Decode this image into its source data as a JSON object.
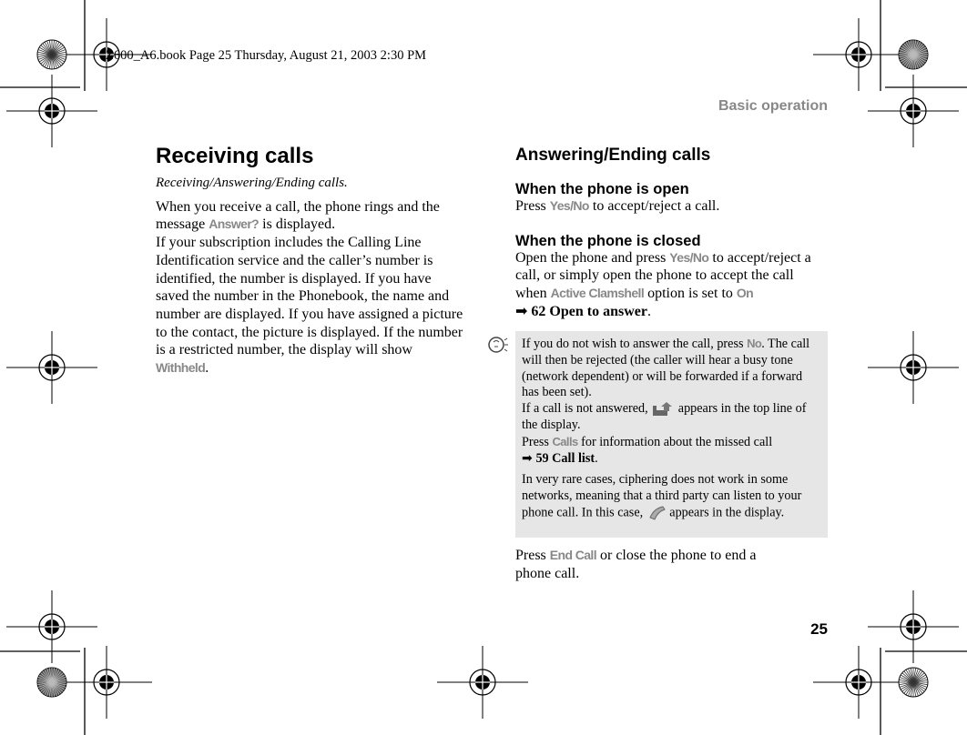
{
  "print_stamp": "Z600_A6.book  Page 25  Thursday, August 21, 2003  2:30 PM",
  "header": {
    "section": "Basic operation",
    "page_number": "25"
  },
  "left": {
    "title": "Receiving calls",
    "subtitle": "Receiving/Answering/Ending calls.",
    "p1a": "When you receive a call, the phone rings and the message ",
    "k_answer": "Answer?",
    "p1b": " is displayed.",
    "p2a": "If your subscription includes the Calling Line Identification service and the caller’s number is identified, the number is displayed. If you have saved the number in the Phonebook, the name and number are displayed. If you have assigned a picture to the contact, the picture is displayed. If the number is a restricted number, the display will show ",
    "k_withheld": "Withheld",
    "p2b": "."
  },
  "right": {
    "title": "Answering/Ending calls",
    "open_heading": "When the phone is open",
    "open_a": "Press ",
    "k_yesno": "Yes/No",
    "open_b": " to accept/reject a call.",
    "closed_heading": "When the phone is closed",
    "closed_a": "Open the phone and press ",
    "k_yesno2": "Yes/No",
    "closed_b": " to accept/reject a call, or simply open the phone to accept the call when ",
    "k_clamshell": "Active Clamshell",
    "closed_c": " option is set to ",
    "k_on": "On",
    "ref1": "62 Open to answer",
    "dot": ".",
    "end_a": "Press ",
    "k_endcall": "End Call",
    "end_b": " or close the phone to end a phone call."
  },
  "note": {
    "icon": "tip-lightbulb-icon",
    "n1a": "If you do not wish to answer the call, press ",
    "k_no": "No",
    "n1b": ". The call will then be rejected (the caller will hear a busy tone (network dependent) or will be forwarded if a forward has been set).",
    "n2a": "If a call is not answered, ",
    "n2b": " appears in the top line of the display.",
    "n3a": "Press ",
    "k_calls": "Calls",
    "n3b": " for information about the missed call",
    "ref2": "59 Call list",
    "dot": ".",
    "n4a": "In very rare cases, ciphering does not work in some networks, meaning that a third party can listen to your phone call. In this case, ",
    "n4b": " appears in the display."
  }
}
